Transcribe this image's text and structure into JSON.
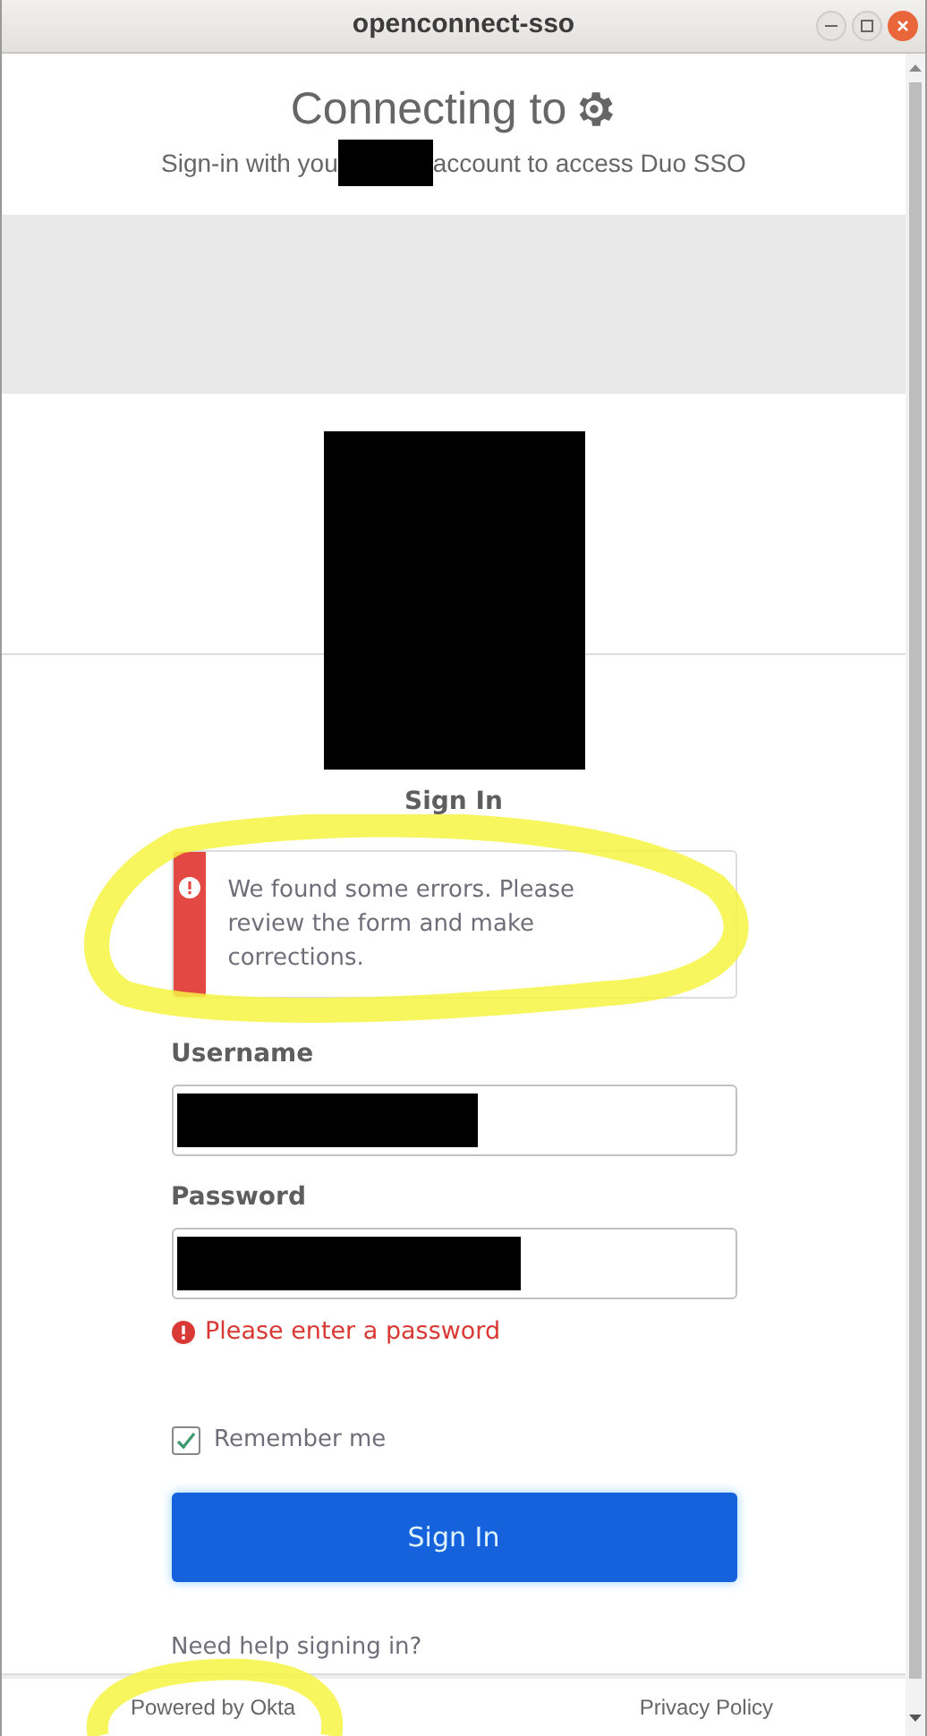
{
  "window": {
    "title": "openconnect-sso"
  },
  "header": {
    "title": "Connecting to",
    "subtitle_before": "Sign-in with you",
    "subtitle_after": "account to access Duo SSO"
  },
  "form": {
    "heading": "Sign In",
    "alert": "We found some errors. Please review the form and make corrections.",
    "fields": [
      {
        "label": "Username"
      },
      {
        "label": "Password",
        "error": "Please enter a password"
      }
    ],
    "remember": {
      "label": "Remember me",
      "checked": true
    },
    "submit": "Sign In",
    "help": "Need help signing in?"
  },
  "footer": {
    "powered_by": "Powered by Okta",
    "privacy": "Privacy Policy"
  }
}
